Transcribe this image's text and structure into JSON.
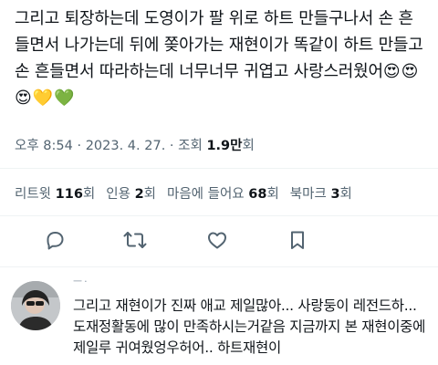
{
  "tweet": {
    "text": "그리고 퇴장하는데 도영이가 팔 위로 하트 만들구나서 손 흔들면서 나가는데 뒤에 쫒아가는 재현이가 똑같이 하트 만들고 손 흔들면서 따라하는데 너무너무 귀엽고 사랑스러웠어",
    "emojis": "😍😍😍💛💚"
  },
  "meta": {
    "time": "오후 8:54",
    "sep1": " · ",
    "date": "2023. 4. 27.",
    "sep2": " · ",
    "views_label": "조회 ",
    "views_value": "1.9만",
    "views_suffix": "회"
  },
  "stats": {
    "retweets": {
      "label": "리트윗 ",
      "value": "116",
      "suffix": "회"
    },
    "quotes": {
      "label": "인용 ",
      "value": "2",
      "suffix": "회"
    },
    "likes": {
      "label": "마음에 들어요 ",
      "value": "68",
      "suffix": "회"
    },
    "bookmarks": {
      "label": "북마크 ",
      "value": "3",
      "suffix": "회"
    }
  },
  "actions": {
    "reply_icon": "reply-icon",
    "retweet_icon": "retweet-icon",
    "like_icon": "heart-icon",
    "bookmark_icon": "bookmark-icon",
    "icon_color": "#536471"
  },
  "reply": {
    "name": "ㅡ·",
    "text": "그리고 재현이가 진짜 애교 제일많아... 사랑둥이 레전드하... 도재정활동에 많이 만족하시는거같음 지금까지 본 재현이중에 제일루 귀여웠엉우허어.. 하트재현이"
  }
}
